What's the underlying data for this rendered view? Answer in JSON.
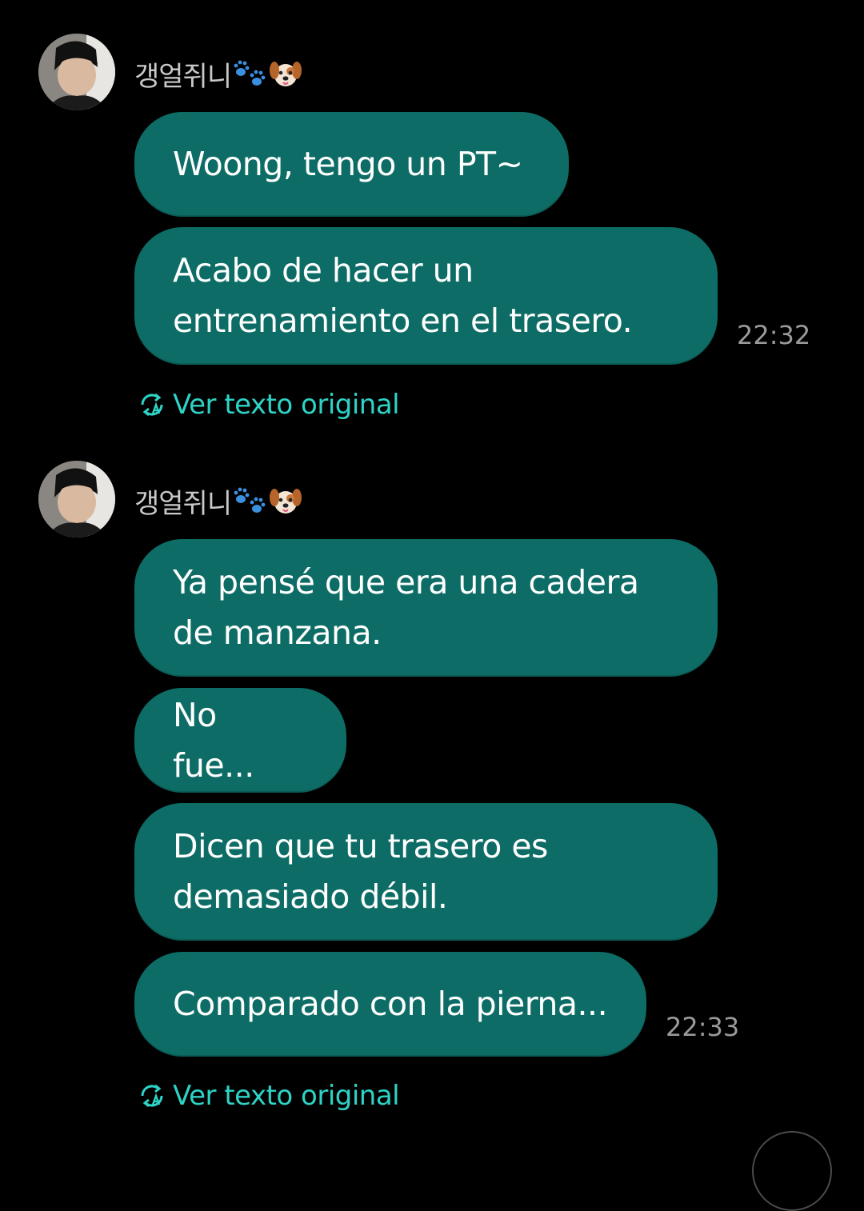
{
  "groups": [
    {
      "sender": {
        "name": "갱얼쥐니",
        "emoji_icons": [
          "paw-prints-icon",
          "dog-face-icon"
        ]
      },
      "messages": [
        {
          "text": "Woong, tengo un PT~"
        },
        {
          "text": "Acabo de hacer un\nentrenamiento en el trasero.",
          "time": "22:32"
        }
      ],
      "translation_link": {
        "icon": "translate-icon",
        "label": "Ver texto original"
      }
    },
    {
      "sender": {
        "name": "갱얼쥐니",
        "emoji_icons": [
          "paw-prints-icon",
          "dog-face-icon"
        ]
      },
      "messages": [
        {
          "text": "Ya pensé que era una cadera\nde manzana."
        },
        {
          "text": "No fue..."
        },
        {
          "text": "Dicen que tu trasero es\ndemasiado débil."
        },
        {
          "text": "Comparado con la pierna...",
          "time": "22:33"
        }
      ],
      "translation_link": {
        "icon": "translate-icon",
        "label": "Ver texto original"
      }
    }
  ],
  "colors": {
    "background": "#000000",
    "bubble": "#0d6d66",
    "link": "#2ed3c6",
    "timestamp": "#9a9a9a",
    "sender_name": "#c9c9c9"
  }
}
